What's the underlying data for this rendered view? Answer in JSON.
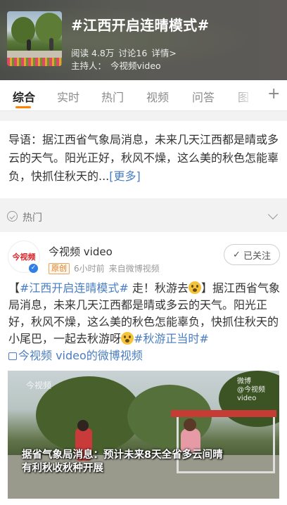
{
  "header": {
    "title": "#江西开启连晴模式#",
    "read_label": "阅读",
    "read_count": "4.8万",
    "discuss_label": "讨论",
    "discuss_count": "16",
    "details": "详情>",
    "host_label": "主持人：",
    "host_name": "今视频video"
  },
  "tabs": [
    "综合",
    "实时",
    "热门",
    "视频",
    "问答",
    "图"
  ],
  "tabs_more": "+",
  "guide": {
    "text": "导语：据江西省气象局消息，未来几天江西都是晴或多云的天气。阳光正好，秋风不燥，这么美的秋色怎能辜负，快抓住秋天的...",
    "more": "[更多]"
  },
  "section": {
    "label": "热门"
  },
  "post": {
    "avatar_text": "今视频",
    "author": "今视频 video",
    "badge": "原创",
    "time": "6小时前",
    "source": "来自微博视频",
    "follow": "已关注",
    "bracket_open": "【",
    "topic": "#江西开启连晴模式#",
    "lead": " 走！秋游去",
    "bracket_close": "】",
    "body": "据江西省气象局消息，未来几天江西都是晴或多云的天气。阳光正好，秋风不燥，这么美的秋色怎能辜负，快抓住秋天的小尾巴，一起去秋游呀",
    "hashtag2": "#秋游正当时#",
    "video_link": "今视频 video的微博视频"
  },
  "video": {
    "watermark_left": "今视频",
    "watermark_right_1": "微博",
    "watermark_right_2": "@今视频video",
    "caption_1": "据省气象局消息：预计未来8天全省多云间晴",
    "caption_2": "有利秋收秋种开展"
  },
  "colors": {
    "accent": "#ff8200",
    "link": "#4a7ec0",
    "verified": "#2f7fe6"
  }
}
